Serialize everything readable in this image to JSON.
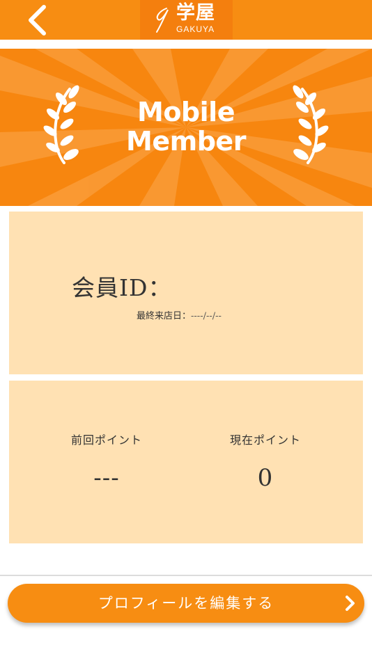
{
  "header": {
    "logo_text": "学屋",
    "logo_subtext": "GAKUYA",
    "back_icon": "chevron-left-icon"
  },
  "banner": {
    "title_line1": "Mobile",
    "title_line2": "Member",
    "ornament_icon": "laurel-icon"
  },
  "member_card": {
    "id_label": "会員ID：",
    "last_visit_label": "最終来店日：",
    "last_visit_value": "----/--/--"
  },
  "points_card": {
    "previous_label": "前回ポイント",
    "previous_value": "---",
    "current_label": "現在ポイント",
    "current_value": "0"
  },
  "footer": {
    "edit_profile_label": "プロフィールを編集する",
    "edit_icon": "chevron-right-icon"
  },
  "colors": {
    "primary": "#f78d12",
    "card_background": "#ffe1b3",
    "text": "#333333"
  }
}
